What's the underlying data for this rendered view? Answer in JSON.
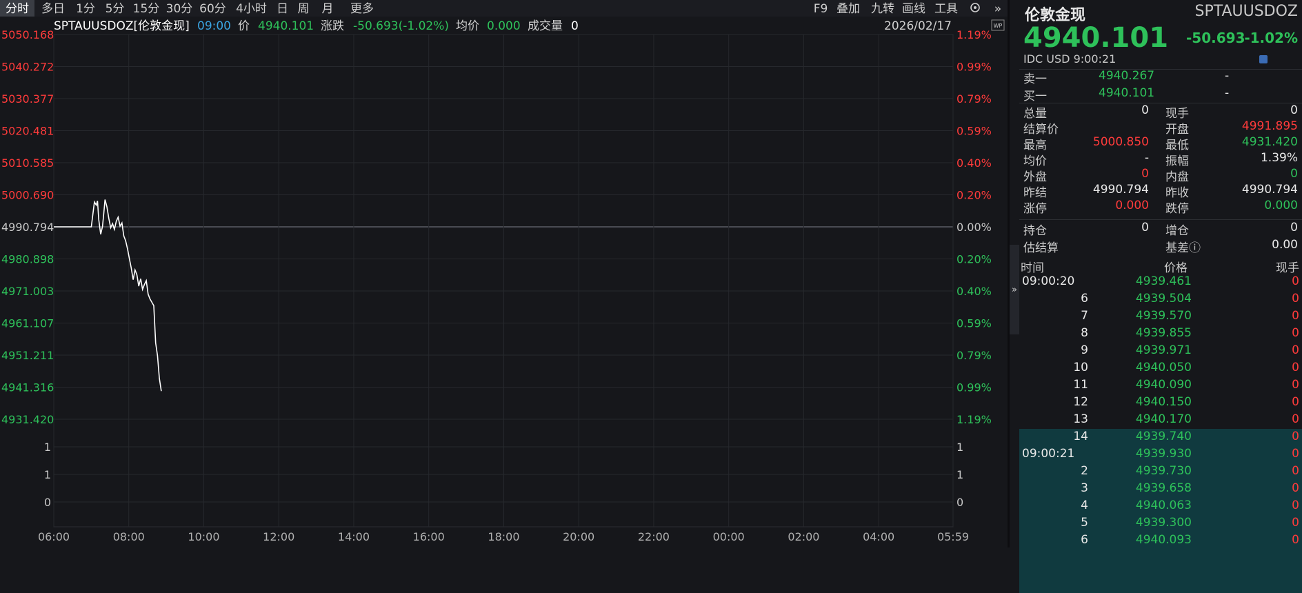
{
  "toolbar": {
    "periods": [
      "分时",
      "多日",
      "1分",
      "5分",
      "15分",
      "30分",
      "60分",
      "4小时",
      "日",
      "周",
      "月",
      "更多"
    ],
    "active_period": "分时",
    "tools": [
      "F9",
      "叠加",
      "九转",
      "画线",
      "工具"
    ]
  },
  "chart": {
    "symbol": "SPTAUUSDOZ[伦敦金现]",
    "time": "09:00",
    "price_label": "价",
    "price": "4940.101",
    "change_label": "涨跌",
    "change": "-50.693(-1.02%)",
    "avg_label": "均价",
    "avg": "0.000",
    "volume_label": "成交量",
    "volume": "0",
    "date": "2026/02/17",
    "wp_badge": "WP",
    "left_axis": [
      "5050.168",
      "5040.272",
      "5030.377",
      "5020.481",
      "5010.585",
      "5000.690",
      "4990.794",
      "4980.898",
      "4971.003",
      "4961.107",
      "4951.211",
      "4941.316",
      "4931.420"
    ],
    "right_axis": [
      "1.19%",
      "0.99%",
      "0.79%",
      "0.59%",
      "0.40%",
      "0.20%",
      "0.00%",
      "0.20%",
      "0.40%",
      "0.59%",
      "0.79%",
      "0.99%",
      "1.19%"
    ],
    "volume_axis": [
      "1",
      "1",
      "0"
    ],
    "time_axis": [
      "06:00",
      "08:00",
      "10:00",
      "12:00",
      "14:00",
      "16:00",
      "18:00",
      "20:00",
      "22:00",
      "00:00",
      "02:00",
      "04:00",
      "05:59"
    ],
    "colors": {
      "up": "#ff3b3b",
      "down": "#2ec15a",
      "flat": "#c8c8c8",
      "line": "#ffffff",
      "time_highlight": "#3aa3e0"
    }
  },
  "chart_data": {
    "type": "line",
    "title": "SPTAUUSDOZ[伦敦金现]",
    "y_range": [
      4931.42,
      5050.168
    ],
    "prev_close": 4990.794,
    "x_range": [
      "06:00",
      "05:59"
    ],
    "points": [
      [
        "06:00",
        4990.8
      ],
      [
        "06:30",
        4990.8
      ],
      [
        "07:00",
        4990.8
      ],
      [
        "07:05",
        4998.5
      ],
      [
        "07:08",
        4997.5
      ],
      [
        "07:10",
        4998.8
      ],
      [
        "07:12",
        4993.0
      ],
      [
        "07:15",
        4988.5
      ],
      [
        "07:18",
        4991.0
      ],
      [
        "07:20",
        4995.0
      ],
      [
        "07:22",
        4999.2
      ],
      [
        "07:25",
        4997.0
      ],
      [
        "07:28",
        4993.5
      ],
      [
        "07:31",
        4990.5
      ],
      [
        "07:34",
        4991.8
      ],
      [
        "07:37",
        4990.0
      ],
      [
        "07:40",
        4992.5
      ],
      [
        "07:43",
        4993.8
      ],
      [
        "07:46",
        4991.0
      ],
      [
        "07:49",
        4992.0
      ],
      [
        "07:52",
        4988.0
      ],
      [
        "07:55",
        4986.5
      ],
      [
        "07:58",
        4984.0
      ],
      [
        "08:01",
        4981.0
      ],
      [
        "08:04",
        4978.0
      ],
      [
        "08:07",
        4974.5
      ],
      [
        "08:10",
        4977.5
      ],
      [
        "08:13",
        4976.0
      ],
      [
        "08:16",
        4972.5
      ],
      [
        "08:19",
        4974.8
      ],
      [
        "08:22",
        4971.5
      ],
      [
        "08:25",
        4973.0
      ],
      [
        "08:28",
        4974.2
      ],
      [
        "08:31",
        4970.0
      ],
      [
        "08:34",
        4968.5
      ],
      [
        "08:37",
        4967.5
      ],
      [
        "08:40",
        4966.5
      ],
      [
        "08:43",
        4955.0
      ],
      [
        "08:46",
        4951.0
      ],
      [
        "08:49",
        4944.0
      ],
      [
        "08:52",
        4940.1
      ]
    ],
    "xlabel": "",
    "ylabel": ""
  },
  "panel": {
    "name": "伦敦金现",
    "code": "SPTAUUSDOZ",
    "price": "4940.101",
    "change": "-50.693",
    "change_pct": "-1.02%",
    "meta": "IDC  USD  9:00:21",
    "ask_label": "卖一",
    "ask_price": "4940.267",
    "ask_vol": "-",
    "bid_label": "买一",
    "bid_price": "4940.101",
    "bid_vol": "-",
    "stats": [
      {
        "l1": "总量",
        "v1": "0",
        "c1": "w",
        "l2": "现手",
        "v2": "0",
        "c2": "w"
      },
      {
        "l1": "结算价",
        "v1": "",
        "c1": "w",
        "l2": "开盘",
        "v2": "4991.895",
        "c2": "r"
      },
      {
        "l1": "最高",
        "v1": "5000.850",
        "c1": "r",
        "l2": "最低",
        "v2": "4931.420",
        "c2": "g"
      },
      {
        "l1": "均价",
        "v1": "-",
        "c1": "w",
        "l2": "振幅",
        "v2": "1.39%",
        "c2": "w"
      },
      {
        "l1": "外盘",
        "v1": "0",
        "c1": "r",
        "l2": "内盘",
        "v2": "0",
        "c2": "g"
      },
      {
        "l1": "昨结",
        "v1": "4990.794",
        "c1": "w",
        "l2": "昨收",
        "v2": "4990.794",
        "c2": "w"
      },
      {
        "l1": "涨停",
        "v1": "0.000",
        "c1": "r",
        "l2": "跌停",
        "v2": "0.000",
        "c2": "g"
      }
    ],
    "stats2": [
      {
        "l1": "持仓",
        "v1": "0",
        "l2": "增仓",
        "v2": "0"
      },
      {
        "l1": "估结算",
        "v1": "",
        "l2": "基差ⓘ",
        "v2": "0.00"
      }
    ],
    "ticks_header": {
      "time": "时间",
      "price": "价格",
      "vol": "现手"
    },
    "ticks": [
      {
        "t": "09:00:20",
        "p": "4939.461",
        "v": "0",
        "full": true
      },
      {
        "t": "6",
        "p": "4939.504",
        "v": "0"
      },
      {
        "t": "7",
        "p": "4939.570",
        "v": "0"
      },
      {
        "t": "8",
        "p": "4939.855",
        "v": "0"
      },
      {
        "t": "9",
        "p": "4939.971",
        "v": "0"
      },
      {
        "t": "10",
        "p": "4940.050",
        "v": "0"
      },
      {
        "t": "11",
        "p": "4940.090",
        "v": "0"
      },
      {
        "t": "12",
        "p": "4940.150",
        "v": "0"
      },
      {
        "t": "13",
        "p": "4940.170",
        "v": "0"
      },
      {
        "t": "14",
        "p": "4939.740",
        "v": "0"
      },
      {
        "t": "09:00:21",
        "p": "4939.930",
        "v": "0",
        "full": true
      },
      {
        "t": "2",
        "p": "4939.730",
        "v": "0"
      },
      {
        "t": "3",
        "p": "4939.658",
        "v": "0"
      },
      {
        "t": "4",
        "p": "4940.063",
        "v": "0"
      },
      {
        "t": "5",
        "p": "4939.300",
        "v": "0"
      },
      {
        "t": "6",
        "p": "4940.093",
        "v": "0"
      }
    ],
    "collapse_glyph": "»"
  }
}
